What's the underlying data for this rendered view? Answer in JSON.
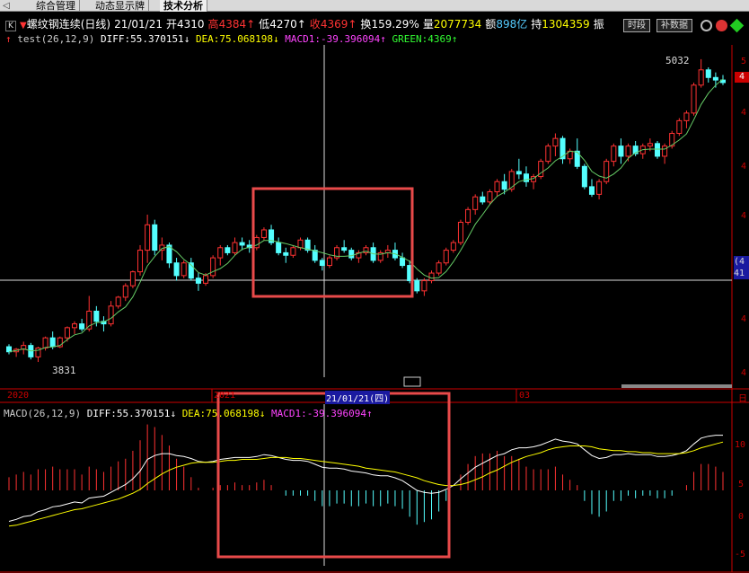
{
  "tabs": [
    "综合管理",
    "动态显示牌",
    "技术分析"
  ],
  "header": {
    "code_box": "K",
    "name": "螺纹钢连续(日线)",
    "date": "21/01/21",
    "open_label": "开",
    "open": "4310",
    "high_label": "高",
    "high": "4384",
    "low_label": "低",
    "low": "4270",
    "close_label": "收",
    "close": "4369",
    "turnover_label": "换",
    "turnover": "159.29%",
    "volume_label": "量",
    "volume": "2077734",
    "amount_label": "额",
    "amount": "898亿",
    "hold_label": "持",
    "hold": "1304359",
    "amp_label": "振"
  },
  "buttons": {
    "period": "时段",
    "reweight": "补数据"
  },
  "main_indicator": {
    "name": "test(26,12,9)",
    "diff": "DIFF:55.370151",
    "dea": "DEA:75.068198",
    "macd1": "MACD1:-39.396094",
    "green": "GREEN:4369"
  },
  "sub_indicator": {
    "name": "MACD(26,12,9)",
    "diff": "DIFF:55.370151",
    "dea": "DEA:75.068198",
    "macd1": "MACD1:-39.396094"
  },
  "price_labels": {
    "high": "5032",
    "low": "3831"
  },
  "time_axis": {
    "left": "2020",
    "mid1": "2021",
    "cursor": "21/01/21(四)",
    "mid2": "03",
    "right": "日"
  },
  "right_axis": {
    "a": "5",
    "b": "4",
    "c": "4",
    "d": "4",
    "e": "4",
    "f": "4",
    "g": "4",
    "tag1": "(4",
    "tag2": "41"
  },
  "macd_axis": {
    "a": "10",
    "b": "5",
    "c": "0",
    "d": "-5"
  },
  "colors": {
    "up": "#ff3232",
    "down": "#54ffff",
    "ma": "#ffff00",
    "diff": "#ffffff",
    "highlight": "#e84a4a"
  },
  "chart_data": {
    "type": "candlestick",
    "price_axis": {
      "min": 3780,
      "max": 5060
    },
    "candles": [
      [
        3900,
        3910,
        3870,
        3880
      ],
      [
        3880,
        3895,
        3860,
        3890
      ],
      [
        3890,
        3920,
        3870,
        3905
      ],
      [
        3905,
        3915,
        3850,
        3860
      ],
      [
        3860,
        3900,
        3840,
        3895
      ],
      [
        3895,
        3940,
        3885,
        3935
      ],
      [
        3935,
        3960,
        3890,
        3900
      ],
      [
        3900,
        3940,
        3895,
        3935
      ],
      [
        3935,
        3980,
        3920,
        3975
      ],
      [
        3975,
        4000,
        3950,
        3990
      ],
      [
        3990,
        4010,
        3960,
        3970
      ],
      [
        3970,
        4100,
        3960,
        4040
      ],
      [
        4040,
        4060,
        3980,
        4000
      ],
      [
        4000,
        4020,
        3960,
        3990
      ],
      [
        3990,
        4080,
        3980,
        4060
      ],
      [
        4060,
        4100,
        4050,
        4095
      ],
      [
        4095,
        4150,
        4080,
        4140
      ],
      [
        4140,
        4200,
        4130,
        4195
      ],
      [
        4195,
        4300,
        4180,
        4280
      ],
      [
        4280,
        4420,
        4230,
        4380
      ],
      [
        4380,
        4400,
        4260,
        4280
      ],
      [
        4280,
        4330,
        4240,
        4300
      ],
      [
        4300,
        4310,
        4210,
        4230
      ],
      [
        4230,
        4250,
        4160,
        4180
      ],
      [
        4180,
        4240,
        4170,
        4230
      ],
      [
        4230,
        4250,
        4160,
        4170
      ],
      [
        4170,
        4190,
        4120,
        4150
      ],
      [
        4150,
        4190,
        4140,
        4180
      ],
      [
        4180,
        4260,
        4170,
        4250
      ],
      [
        4250,
        4300,
        4220,
        4290
      ],
      [
        4290,
        4300,
        4260,
        4270
      ],
      [
        4270,
        4330,
        4260,
        4310
      ],
      [
        4310,
        4330,
        4280,
        4300
      ],
      [
        4300,
        4320,
        4270,
        4290
      ],
      [
        4290,
        4340,
        4280,
        4330
      ],
      [
        4330,
        4370,
        4320,
        4360
      ],
      [
        4360,
        4380,
        4300,
        4310
      ],
      [
        4310,
        4330,
        4260,
        4270
      ],
      [
        4270,
        4290,
        4230,
        4260
      ],
      [
        4260,
        4300,
        4250,
        4290
      ],
      [
        4290,
        4330,
        4280,
        4320
      ],
      [
        4320,
        4330,
        4270,
        4280
      ],
      [
        4280,
        4300,
        4230,
        4240
      ],
      [
        4240,
        4250,
        4200,
        4220
      ],
      [
        4220,
        4260,
        4210,
        4250
      ],
      [
        4250,
        4300,
        4240,
        4290
      ],
      [
        4290,
        4320,
        4270,
        4280
      ],
      [
        4280,
        4290,
        4240,
        4250
      ],
      [
        4250,
        4280,
        4230,
        4270
      ],
      [
        4270,
        4300,
        4260,
        4290
      ],
      [
        4290,
        4310,
        4230,
        4240
      ],
      [
        4240,
        4280,
        4230,
        4270
      ],
      [
        4270,
        4300,
        4250,
        4280
      ],
      [
        4280,
        4310,
        4240,
        4250
      ],
      [
        4250,
        4270,
        4210,
        4220
      ],
      [
        4220,
        4240,
        4150,
        4160
      ],
      [
        4160,
        4170,
        4110,
        4120
      ],
      [
        4120,
        4170,
        4100,
        4160
      ],
      [
        4160,
        4200,
        4150,
        4190
      ],
      [
        4190,
        4240,
        4180,
        4230
      ],
      [
        4230,
        4290,
        4220,
        4280
      ],
      [
        4280,
        4320,
        4270,
        4310
      ],
      [
        4310,
        4400,
        4300,
        4390
      ],
      [
        4390,
        4450,
        4380,
        4440
      ],
      [
        4440,
        4500,
        4420,
        4490
      ],
      [
        4490,
        4510,
        4460,
        4470
      ],
      [
        4470,
        4520,
        4460,
        4510
      ],
      [
        4510,
        4560,
        4490,
        4550
      ],
      [
        4550,
        4580,
        4500,
        4520
      ],
      [
        4520,
        4600,
        4510,
        4590
      ],
      [
        4590,
        4640,
        4560,
        4580
      ],
      [
        4580,
        4610,
        4530,
        4550
      ],
      [
        4550,
        4580,
        4520,
        4570
      ],
      [
        4570,
        4640,
        4560,
        4630
      ],
      [
        4630,
        4700,
        4620,
        4690
      ],
      [
        4690,
        4740,
        4650,
        4720
      ],
      [
        4720,
        4730,
        4620,
        4640
      ],
      [
        4640,
        4680,
        4620,
        4670
      ],
      [
        4670,
        4720,
        4600,
        4610
      ],
      [
        4610,
        4620,
        4520,
        4530
      ],
      [
        4530,
        4560,
        4490,
        4500
      ],
      [
        4500,
        4560,
        4480,
        4550
      ],
      [
        4550,
        4640,
        4540,
        4630
      ],
      [
        4630,
        4700,
        4610,
        4690
      ],
      [
        4690,
        4720,
        4620,
        4650
      ],
      [
        4650,
        4700,
        4630,
        4690
      ],
      [
        4690,
        4710,
        4650,
        4660
      ],
      [
        4660,
        4700,
        4640,
        4690
      ],
      [
        4690,
        4720,
        4670,
        4700
      ],
      [
        4700,
        4710,
        4640,
        4650
      ],
      [
        4650,
        4700,
        4620,
        4690
      ],
      [
        4690,
        4750,
        4680,
        4740
      ],
      [
        4740,
        4800,
        4730,
        4790
      ],
      [
        4790,
        4830,
        4760,
        4820
      ],
      [
        4820,
        4940,
        4810,
        4930
      ],
      [
        4930,
        5032,
        4920,
        4990
      ],
      [
        4990,
        5000,
        4940,
        4960
      ],
      [
        4960,
        4980,
        4920,
        4950
      ],
      [
        4950,
        4970,
        4930,
        4940
      ]
    ],
    "diff": [
      -20,
      -18,
      -15,
      -14,
      -10,
      -8,
      -5,
      -4,
      -2,
      0,
      -1,
      4,
      5,
      6,
      10,
      14,
      18,
      24,
      32,
      44,
      48,
      50,
      50,
      48,
      47,
      45,
      42,
      41,
      42,
      44,
      45,
      46,
      46,
      46,
      47,
      49,
      48,
      46,
      44,
      43,
      43,
      42,
      39,
      36,
      35,
      35,
      34,
      32,
      31,
      30,
      28,
      27,
      27,
      25,
      22,
      17,
      12,
      10,
      9,
      10,
      13,
      17,
      24,
      30,
      36,
      40,
      44,
      48,
      50,
      54,
      56,
      56,
      57,
      59,
      62,
      65,
      63,
      62,
      60,
      54,
      48,
      45,
      46,
      49,
      49,
      50,
      49,
      49,
      49,
      47,
      47,
      48,
      50,
      53,
      60,
      66,
      68,
      69,
      69
    ],
    "dea": [
      -25,
      -24,
      -22,
      -20,
      -18,
      -16,
      -14,
      -12,
      -10,
      -8,
      -7,
      -5,
      -3,
      -1,
      1,
      3,
      6,
      9,
      13,
      19,
      24,
      29,
      33,
      36,
      38,
      40,
      41,
      41,
      41,
      42,
      43,
      43,
      44,
      44,
      44,
      45,
      46,
      46,
      46,
      45,
      45,
      44,
      43,
      42,
      41,
      40,
      39,
      38,
      37,
      35,
      34,
      33,
      32,
      31,
      29,
      27,
      25,
      22,
      20,
      18,
      17,
      17,
      18,
      20,
      23,
      26,
      30,
      33,
      37,
      41,
      44,
      47,
      49,
      51,
      54,
      56,
      57,
      58,
      58,
      58,
      57,
      55,
      54,
      53,
      53,
      52,
      52,
      51,
      51,
      50,
      50,
      50,
      50,
      51,
      53,
      56,
      58,
      60,
      62
    ],
    "macd_axis": {
      "min": -13,
      "max": 13
    }
  }
}
